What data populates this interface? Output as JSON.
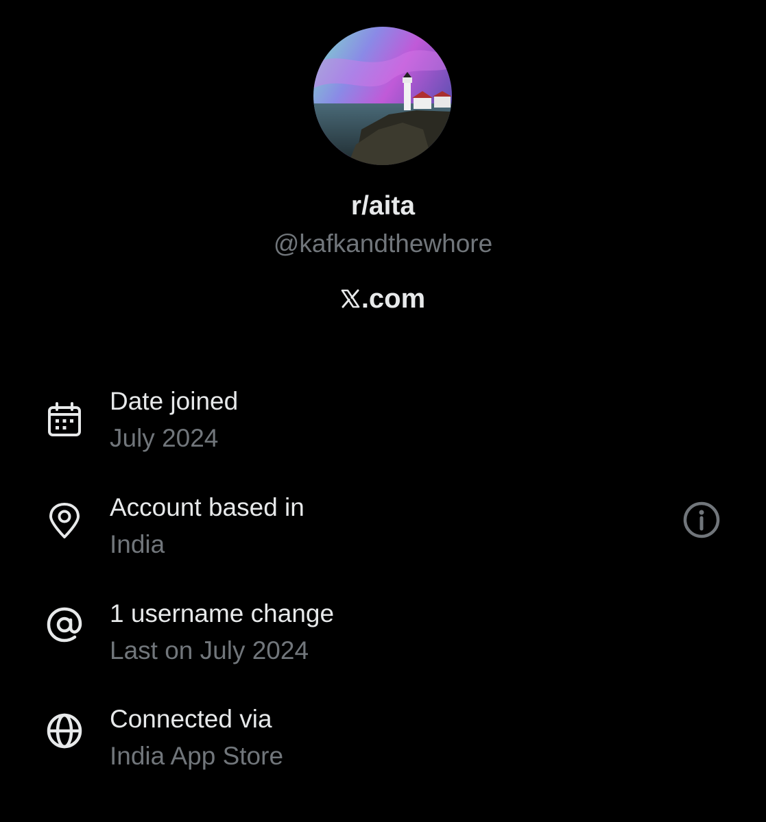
{
  "profile": {
    "display_name": "r/aita",
    "handle": "@kafkandthewhore",
    "site": ".com",
    "site_logo_icon": "x-logo-icon"
  },
  "colors": {
    "background": "#000000",
    "primary_text": "#e7e9ea",
    "secondary_text": "#71767b"
  },
  "details": [
    {
      "icon": "calendar-icon",
      "title": "Date joined",
      "value": "July 2024"
    },
    {
      "icon": "location-pin-icon",
      "title": "Account based in",
      "value": "India",
      "action_icon": "info-icon"
    },
    {
      "icon": "at-sign-icon",
      "title": "1 username change",
      "value": "Last on July 2024"
    },
    {
      "icon": "globe-icon",
      "title": "Connected via",
      "value": "India App Store"
    }
  ]
}
